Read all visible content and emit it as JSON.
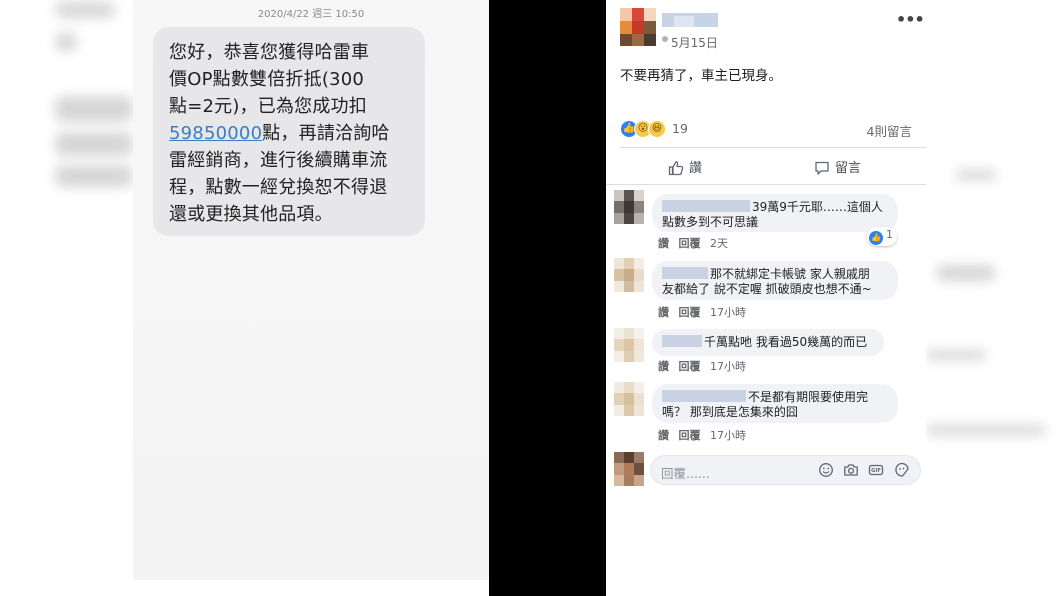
{
  "sms": {
    "timestamp": "2020/4/22 週三 10:50",
    "lines": {
      "l1": "您好，恭喜您獲得哈雷車",
      "l2": "價OP點數雙倍折抵(300",
      "l3": "點=2元)，已為您成功扣",
      "l4_link": "59850000",
      "l4_rest": "點，再請洽詢哈",
      "l5": "雷經銷商，進行後續購車流",
      "l6": "程，點數一經兌換恕不得退",
      "l7": "還或更換其他品項。"
    }
  },
  "post": {
    "date": "5月15日",
    "text": "不要再猜了，車主已現身。",
    "reaction_count": "19",
    "reaction_icons": [
      "like-icon",
      "wow-icon",
      "haha-icon"
    ],
    "comment_count": "4則留言",
    "like_label": "讚",
    "comment_label": "留言"
  },
  "comments": [
    {
      "line1": "39萬9千元耶……這個人",
      "line2": "點數多到不可思議",
      "like": "讚",
      "reply": "回覆",
      "time": "2天",
      "reaction_count": "1"
    },
    {
      "line1": "那不就綁定卡帳號 家人親戚朋",
      "line2": "友都給了 說不定喔 抓破頭皮也想不通~",
      "like": "讚",
      "reply": "回覆",
      "time": "17小時"
    },
    {
      "line1": "千萬點吔 我看過50幾萬的而已",
      "like": "讚",
      "reply": "回覆",
      "time": "17小時"
    },
    {
      "line1": "不是都有期限要使用完",
      "line2": "嗎？ 那到底是怎集來的囧",
      "like": "讚",
      "reply": "回覆",
      "time": "17小時"
    }
  ],
  "reply_box": {
    "placeholder": "回覆......",
    "icons": [
      "emoji-icon",
      "camera-icon",
      "gif-icon",
      "sticker-icon"
    ]
  },
  "colors": {
    "link": "#3b7dbf",
    "fb_blue": "#2e7ff0",
    "bubble_gray": "#f0f2f5"
  }
}
